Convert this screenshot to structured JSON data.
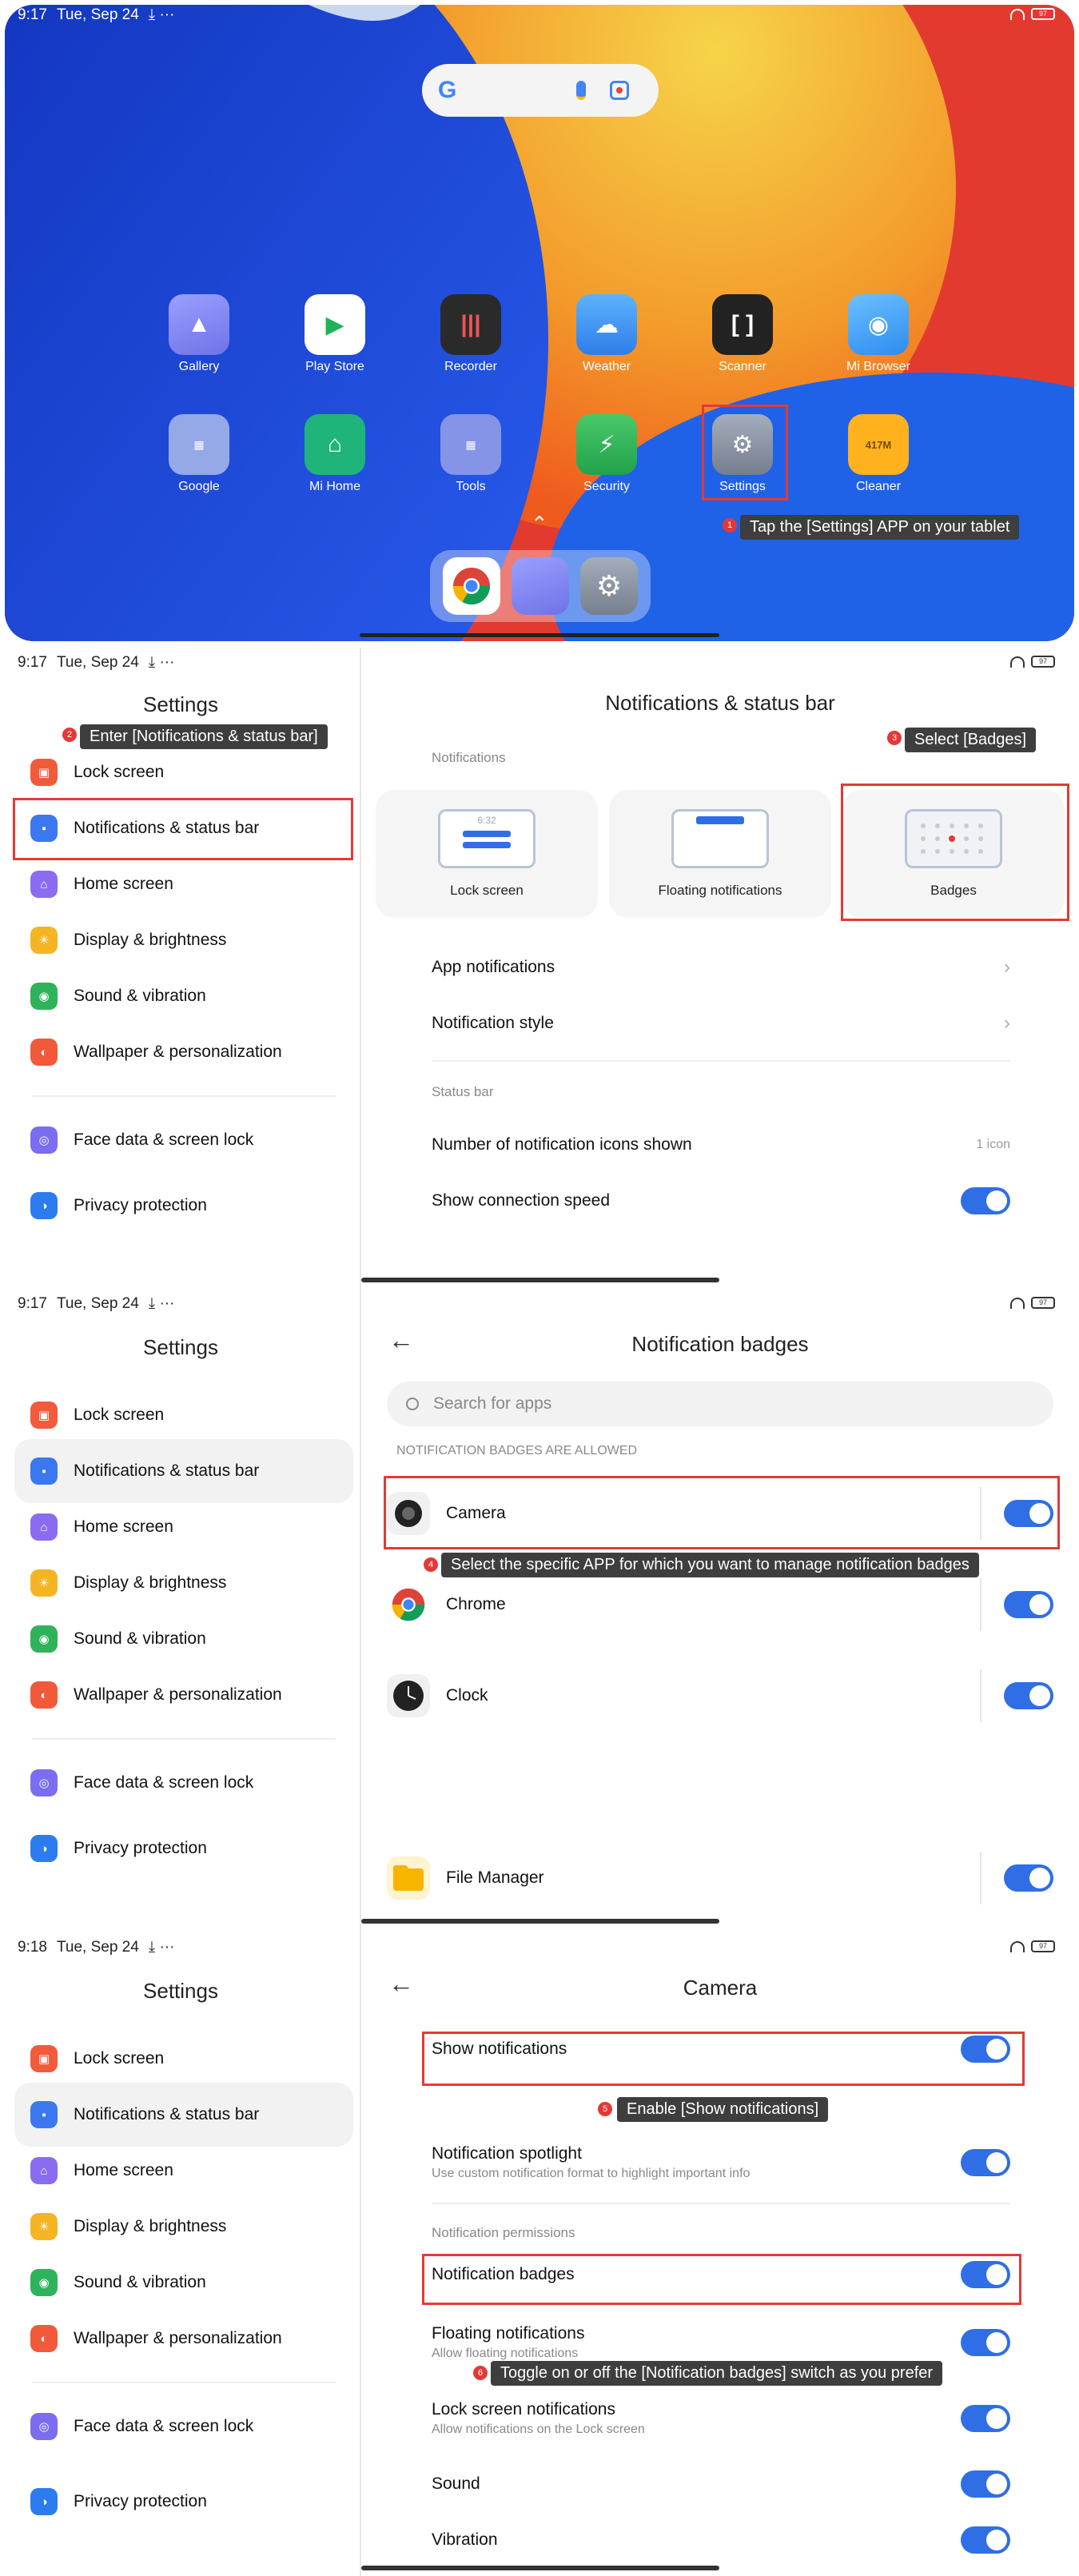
{
  "home": {
    "status_time": "9:17",
    "status_date": "Tue, Sep 24",
    "status_extra": "⤓ ···",
    "battery": "97",
    "search_logo": "G",
    "apps_row1": [
      {
        "label": "Gallery",
        "icon": "gallery-icon",
        "color": "#7b7ff0"
      },
      {
        "label": "Play Store",
        "icon": "play-store-icon",
        "color": "#ffffff"
      },
      {
        "label": "Recorder",
        "icon": "recorder-icon",
        "color": "#2a2a2a"
      },
      {
        "label": "Weather",
        "icon": "weather-icon",
        "color": "#3f8ff0"
      },
      {
        "label": "Scanner",
        "icon": "scanner-icon",
        "color": "#222222"
      },
      {
        "label": "Mi Browser",
        "icon": "browser-icon",
        "color": "#4aa3f7"
      }
    ],
    "apps_row2": [
      {
        "label": "Google",
        "icon": "google-folder-icon",
        "color": "#8a9bd8"
      },
      {
        "label": "Mi Home",
        "icon": "mi-home-icon",
        "color": "#1fb57a"
      },
      {
        "label": "Tools",
        "icon": "tools-folder-icon",
        "color": "#7f89d9"
      },
      {
        "label": "Security",
        "icon": "security-icon",
        "color": "#31b653"
      },
      {
        "label": "Settings",
        "icon": "settings-icon",
        "color": "#8c96a6"
      },
      {
        "label": "Cleaner",
        "icon": "cleaner-icon",
        "color": "#ffb21d"
      }
    ],
    "cleaner_text": "417M",
    "callout_1": "Tap the [Settings] APP on your tablet",
    "step_1": "1"
  },
  "settings_menu": {
    "title": "Settings",
    "items": [
      {
        "label": "Lock screen",
        "color": "#f25a3c"
      },
      {
        "label": "Notifications & status bar",
        "color": "#3b78f0"
      },
      {
        "label": "Home screen",
        "color": "#8a6cf0"
      },
      {
        "label": "Display & brightness",
        "color": "#f5b523"
      },
      {
        "label": "Sound & vibration",
        "color": "#2fb35a"
      },
      {
        "label": "Wallpaper & personalization",
        "color": "#f2593a"
      },
      {
        "label": "Face data & screen lock",
        "color": "#7a6df0"
      },
      {
        "label": "Privacy protection",
        "color": "#2c7cf0"
      }
    ]
  },
  "screen2": {
    "time": "9:17",
    "date": "Tue, Sep 24",
    "extra": "⤓ ···",
    "battery": "97",
    "callout_2": "Enter [Notifications & status bar]",
    "step_2": "2",
    "right_title": "Notifications & status bar",
    "section_notifications": "Notifications",
    "callout_3": "Select [Badges]",
    "step_3": "3",
    "cards": [
      "Lock screen",
      "Floating notifications",
      "Badges"
    ],
    "lock_mock_time": "6:32",
    "row_app_notifications": "App notifications",
    "row_notification_style": "Notification style",
    "section_status_bar": "Status bar",
    "row_icons_shown": "Number of notification icons shown",
    "icons_shown_value": "1 icon",
    "row_connection_speed": "Show connection speed"
  },
  "screen3": {
    "time": "9:17",
    "date": "Tue, Sep 24",
    "extra": "⤓ ···",
    "battery": "97",
    "right_title": "Notification badges",
    "search_placeholder": "Search for apps",
    "section": "NOTIFICATION BADGES ARE ALLOWED",
    "apps": [
      "Camera",
      "Chrome",
      "Clock",
      "File Manager"
    ],
    "callout_4": "Select the specific APP for which you want to manage notification badges",
    "step_4": "4"
  },
  "screen4": {
    "time": "9:18",
    "date": "Tue, Sep 24",
    "extra": "⤓ ···",
    "battery": "97",
    "right_title": "Camera",
    "show_notifications": "Show notifications",
    "callout_5": "Enable [Show notifications]",
    "step_5": "5",
    "spotlight": "Notification spotlight",
    "spotlight_sub": "Use custom notification format to highlight important info",
    "section_permissions": "Notification permissions",
    "notification_badges": "Notification badges",
    "floating": "Floating notifications",
    "floating_sub": "Allow floating notifications",
    "callout_6": "Toggle on or off the [Notification badges] switch as you prefer",
    "step_6": "6",
    "lock_notifications": "Lock screen notifications",
    "lock_sub": "Allow notifications on the Lock screen",
    "sound": "Sound",
    "vibration": "Vibration"
  }
}
